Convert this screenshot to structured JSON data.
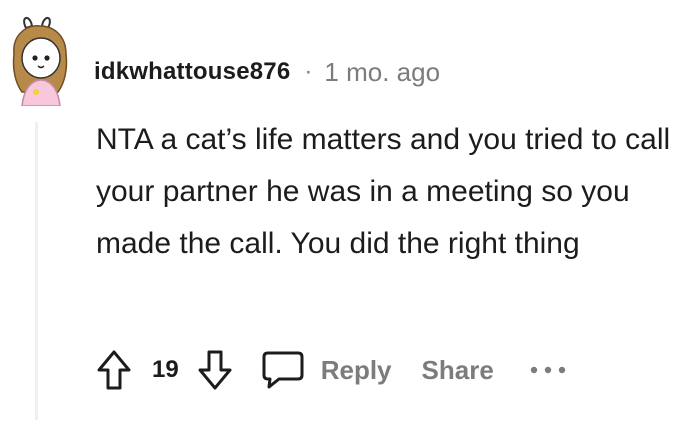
{
  "comment": {
    "username": "idkwhattouse876",
    "separator": "·",
    "timestamp": "1 mo. ago",
    "body": "NTA a cat’s life matters and you tried to call your partner he was in a meeting so you made the call. You did the right thing",
    "score": "19"
  },
  "actions": {
    "reply_label": "Reply",
    "share_label": "Share"
  },
  "icons": {
    "upvote": "arrow-up-icon",
    "downvote": "arrow-down-icon",
    "comment": "speech-bubble-icon",
    "more": "ellipsis-icon"
  },
  "colors": {
    "text": "#1c1c1c",
    "muted": "#7c7c7c",
    "thread_line": "#edeff1"
  }
}
